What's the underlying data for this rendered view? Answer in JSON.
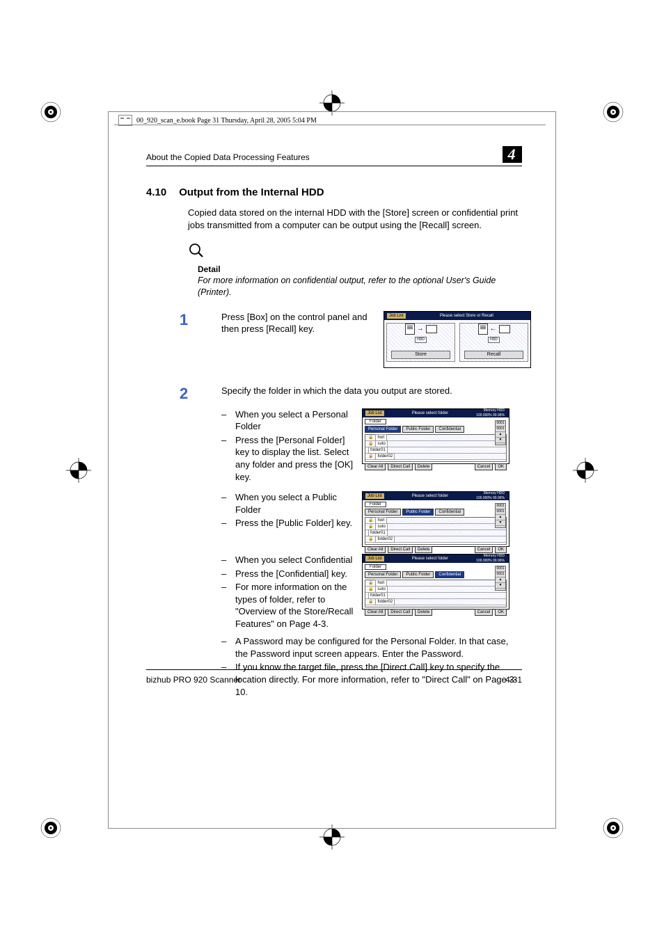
{
  "frame_header": "00_920_scan_e.book  Page 31  Thursday, April 28, 2005  5:04 PM",
  "running_head": "About the Copied Data Processing Features",
  "chapter_number": "4",
  "section_number": "4.10",
  "section_title": "Output from the Internal HDD",
  "intro": "Copied data stored on the internal HDD with the [Store] screen or confidential print jobs transmitted from a computer can be output using the [Recall] screen.",
  "detail_label": "Detail",
  "detail_body": "For more information on confidential output, refer to the optional User's Guide (Printer).",
  "steps": [
    {
      "num": "1",
      "text": "Press [Box] on the control panel and then press [Recall] key."
    },
    {
      "num": "2",
      "text": "Specify the folder in which the data you output are stored."
    }
  ],
  "step2_bullets_a": [
    "When you select a Personal Folder",
    "Press the [Personal Folder] key to display the list. Select any folder and press the [OK] key."
  ],
  "step2_bullets_b": [
    "When you select a Public Folder",
    "Press the [Public Folder] key."
  ],
  "step2_bullets_c": [
    "When you select Confidential",
    "Press the [Confidential] key.",
    "For more information on the types of folder, refer to \"Overview of the Store/Recall Features\" on Page 4-3.",
    "A Password may be configured for the Personal Folder. In that case, the Password input screen appears. Enter the Password.",
    "If you know the target file, press the [Direct Call] key to specify the location directly. For more information, refer to \"Direct Call\" on Page 3-10."
  ],
  "screenshot1": {
    "job_list": "Job List",
    "message": "Please select Store or Recall",
    "store": "Store",
    "recall": "Recall",
    "hdd": "HDD"
  },
  "screenshot_folder": {
    "job_list": "Job List",
    "message": "Please select folder",
    "memory_label": "Memory",
    "memory_value": "100.000%",
    "hdd_label": "HDD",
    "hdd_value": "99.96%",
    "folder_tab": "Folder",
    "tabs": [
      "Personal Folder",
      "Public Folder",
      "Confidential"
    ],
    "rows": [
      "hori",
      "suto",
      "folder01",
      "folder02"
    ],
    "side_nums": [
      "0001",
      "0001"
    ],
    "buttons": [
      "Clear All",
      "Direct Call",
      "Delete",
      "Cancel",
      "OK"
    ]
  },
  "footer_left": "bizhub PRO 920 Scanner",
  "footer_right": "4-31"
}
